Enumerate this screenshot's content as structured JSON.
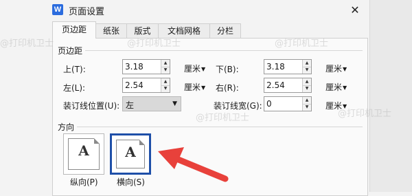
{
  "window": {
    "icon_text": "W",
    "title": "页面设置",
    "close": "✕"
  },
  "tabs": [
    {
      "label": "页边距"
    },
    {
      "label": "纸张"
    },
    {
      "label": "版式"
    },
    {
      "label": "文档网格"
    },
    {
      "label": "分栏"
    }
  ],
  "margins": {
    "section": "页边距",
    "top": {
      "label": "上(T):",
      "value": "3.18",
      "unit": "厘米"
    },
    "bottom": {
      "label": "下(B):",
      "value": "3.18",
      "unit": "厘米"
    },
    "left": {
      "label": "左(L):",
      "value": "2.54",
      "unit": "厘米"
    },
    "right": {
      "label": "右(R):",
      "value": "2.54",
      "unit": "厘米"
    },
    "gutter_pos": {
      "label": "装订线位置(U):",
      "value": "左"
    },
    "gutter": {
      "label": "装订线宽(G):",
      "value": "0",
      "unit": "厘米"
    }
  },
  "orientation": {
    "section": "方向",
    "portrait": {
      "label": "纵向(P)",
      "icon": "A"
    },
    "landscape": {
      "label": "横向(S)",
      "icon": "A"
    },
    "selected": "landscape"
  },
  "watermark": "@打印机卫士",
  "colors": {
    "accent": "#1e4fa8",
    "arrow": "#e8413b"
  }
}
